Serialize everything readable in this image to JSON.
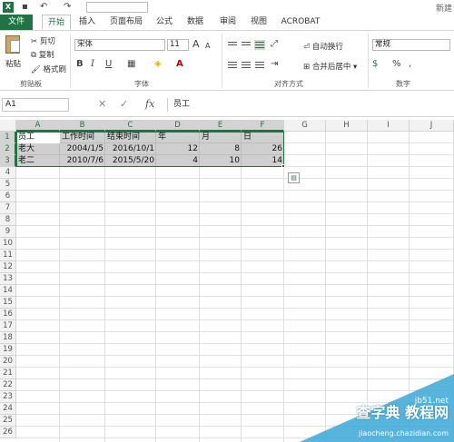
{
  "qat": {
    "logo": "X",
    "undo": "↶",
    "redo": "↷",
    "save": "▪",
    "right_text": "新建"
  },
  "tabs": [
    "文件",
    "开始",
    "插入",
    "页面布局",
    "公式",
    "数据",
    "审阅",
    "视图",
    "ACROBAT"
  ],
  "ribbon": {
    "clipboard": {
      "paste": "粘贴",
      "cut": "剪切",
      "copy": "复制",
      "format_painter": "格式刷",
      "label": "剪贴板"
    },
    "font": {
      "name": "宋体",
      "size": "11",
      "bold": "B",
      "italic": "I",
      "underline": "U",
      "grow": "A",
      "shrink": "A",
      "label": "字体"
    },
    "alignment": {
      "wrap": "自动换行",
      "merge": "合并后居中",
      "label": "对齐方式"
    },
    "number": {
      "format": "常规",
      "percent": "%",
      "comma": ",",
      "label": "数字"
    }
  },
  "formula_bar": {
    "name_box": "A1",
    "cancel": "✕",
    "enter": "✓",
    "fx": "fx",
    "content": "员工"
  },
  "columns": [
    "A",
    "B",
    "C",
    "D",
    "E",
    "F",
    "G",
    "H",
    "I",
    "J"
  ],
  "rows": [
    "1",
    "2",
    "3",
    "4",
    "5",
    "6",
    "7",
    "8",
    "9",
    "10",
    "11",
    "12",
    "13",
    "14",
    "15",
    "16",
    "17",
    "18",
    "19",
    "20",
    "21",
    "22",
    "23",
    "24",
    "25",
    "26"
  ],
  "table": {
    "header": [
      "员工",
      "工作时间",
      "结束时间",
      "年",
      "月",
      "日"
    ],
    "rows": [
      [
        "老大",
        "2004/1/5",
        "2016/10/1",
        "12",
        "8",
        "26"
      ],
      [
        "老二",
        "2010/7/6",
        "2015/5/20",
        "4",
        "10",
        "14"
      ]
    ]
  },
  "watermark": {
    "site": "jb51.net",
    "text": "查字典 教程网",
    "url": "jiaocheng.chazidian.com"
  },
  "colors": {
    "accent": "#217346",
    "selection": "#808080"
  }
}
